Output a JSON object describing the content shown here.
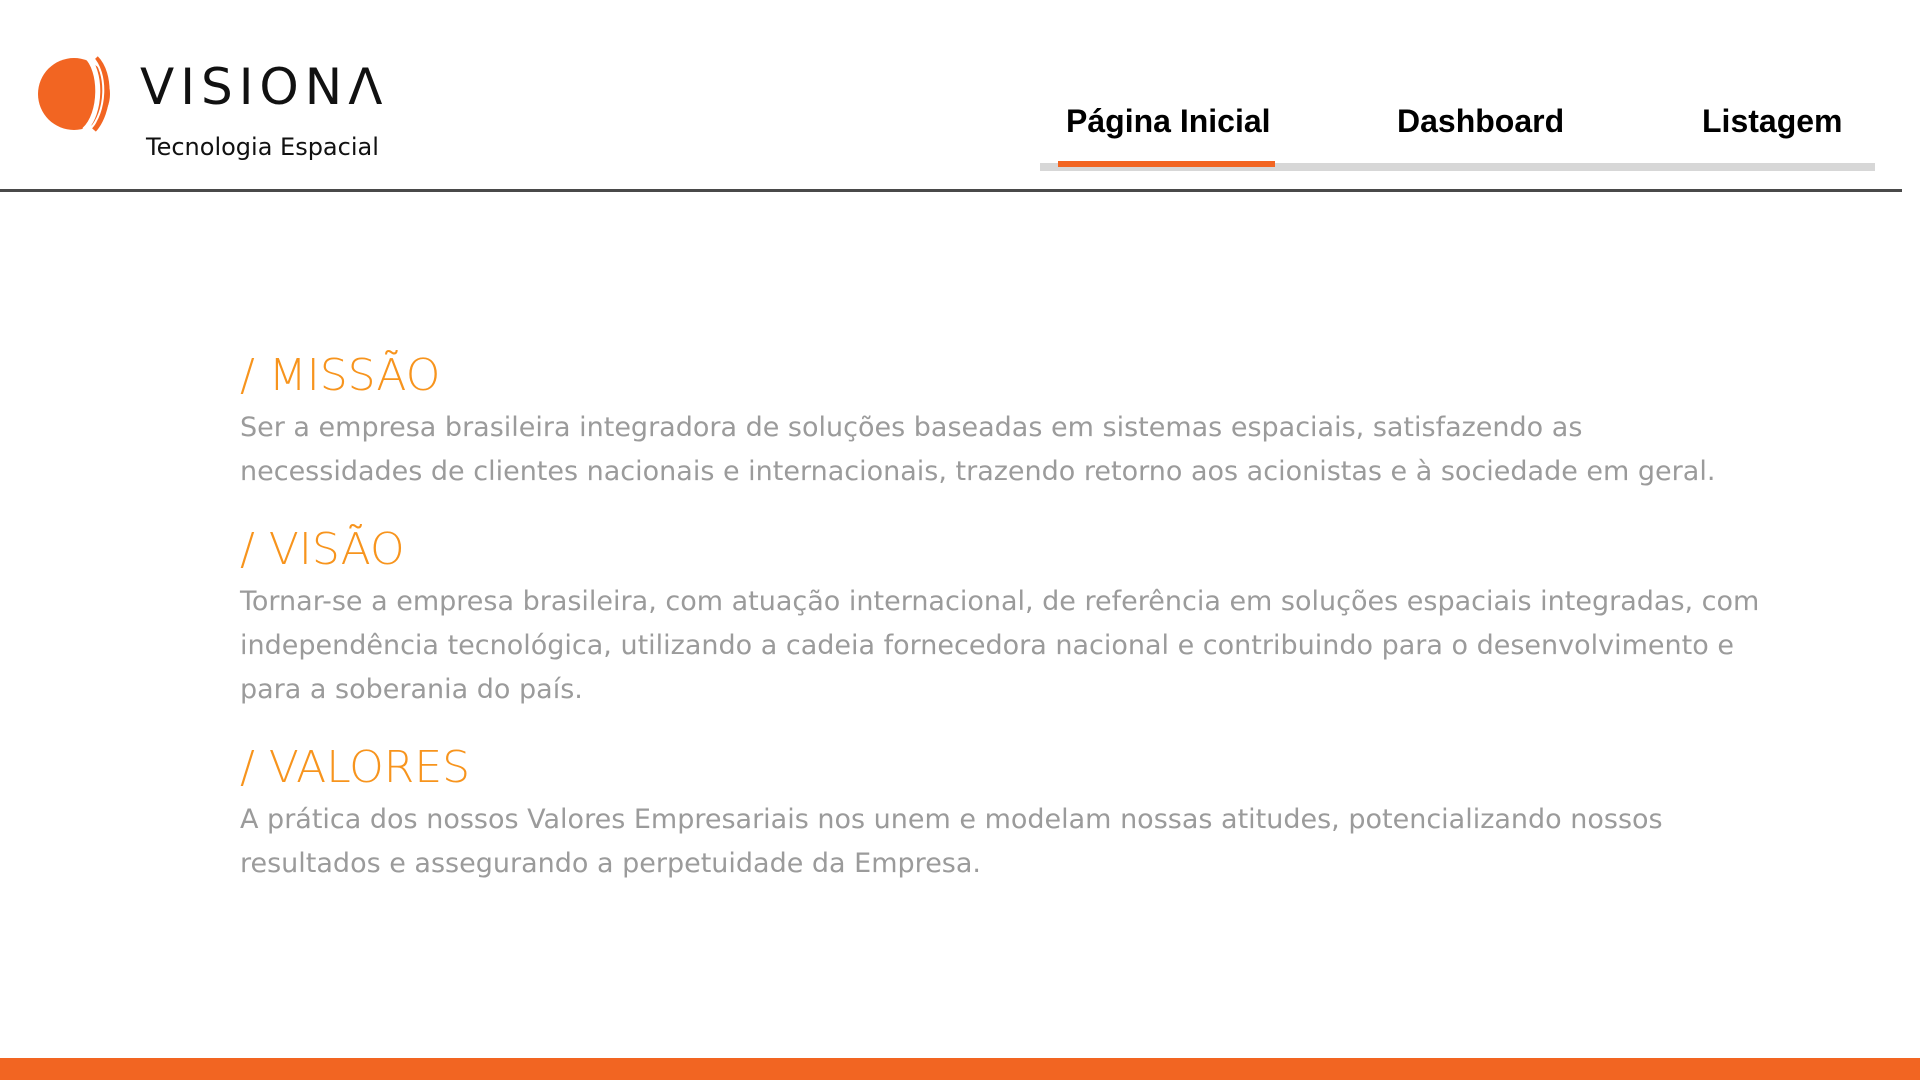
{
  "brand": {
    "name": "VISIONΛ",
    "tagline": "Tecnologia Espacial",
    "logo_icon": "visiona-crescent-icon",
    "accent_color": "#f26522"
  },
  "nav": {
    "tabs": [
      {
        "label": "Página Inicial",
        "active": true
      },
      {
        "label": "Dashboard",
        "active": false
      },
      {
        "label": "Listagem",
        "active": false
      }
    ]
  },
  "main": {
    "sections": [
      {
        "title": "/ MISSÃO",
        "body": "Ser a empresa brasileira integradora de soluções baseadas em sistemas espaciais, satisfazendo as necessidades de clientes nacionais e internacionais, trazendo retorno aos acionistas e à sociedade em geral."
      },
      {
        "title": "/ VISÃO",
        "body": "Tornar-se a empresa brasileira, com atuação internacional, de referência em soluções espaciais integradas, com independência tecnológica, utilizando a cadeia fornecedora nacional e contribuindo para o desenvolvimento e para a soberania do país."
      },
      {
        "title": "/ VALORES",
        "body": "A prática dos nossos Valores Empresariais nos unem e modelam nossas atitudes, potencializando nossos resultados e assegurando a perpetuidade da Empresa."
      }
    ],
    "title_color": "#f7941d",
    "body_color": "#9b9b9b"
  }
}
